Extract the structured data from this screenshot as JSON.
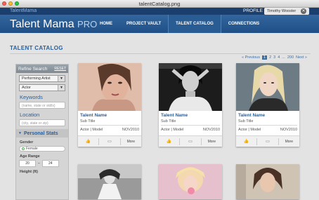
{
  "window": {
    "title": "talentCatalog.png"
  },
  "header": {
    "brand_small": "TalentMama",
    "logo_main": "Talent Mama",
    "logo_suffix": "PRO",
    "profile_label": "PROFILE",
    "user_name": "Timothy Wooster",
    "nav": [
      {
        "label": "HOME"
      },
      {
        "label": "PROJECT VAULT"
      },
      {
        "label": "TALENT CATALOG",
        "active": true
      },
      {
        "label": "CONNECTIONS"
      }
    ]
  },
  "page": {
    "title": "TALENT CATALOG",
    "pager": {
      "prev": "« Previous",
      "pages": [
        "1",
        "2",
        "3",
        "4",
        "...",
        "200"
      ],
      "current": "1",
      "next": "Next »"
    }
  },
  "sidebar": {
    "title": "Refine Search",
    "reset": "RESET",
    "select_category": "Performing Artist",
    "select_role": "Actor",
    "keywords_label": "Keywords",
    "keywords_placeholder": "(name, state or skills)",
    "location_label": "Location",
    "location_placeholder": "(city, state or zip)",
    "section_title": "Personal Stats",
    "gender_label": "Gender",
    "gender_value": "Female",
    "age_label": "Age Range",
    "age_from": "20",
    "age_to": "24",
    "height_label": "Height (ft)"
  },
  "cards": [
    {
      "name": "Talent Name",
      "sub": "Sub Title",
      "roles": "Actor | Model",
      "date": "NOV2010",
      "more": "More"
    },
    {
      "name": "Talent Name",
      "sub": "Sub Title",
      "roles": "Actor | Model",
      "date": "NOV2010",
      "more": "More"
    },
    {
      "name": "Talent Name",
      "sub": "Sub Title",
      "roles": "Actor | Model",
      "date": "NOV2010",
      "more": "More"
    }
  ],
  "icons": {
    "like": "thumbs-up-icon",
    "comment": "comment-icon"
  },
  "colors": {
    "accent": "#2b5f98",
    "header": "#1f4f86"
  }
}
